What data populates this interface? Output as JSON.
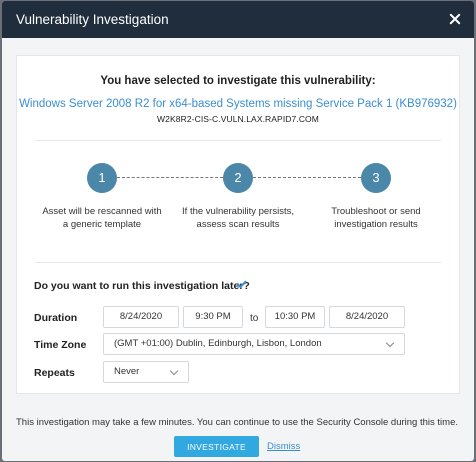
{
  "dialog": {
    "title": "Vulnerability Investigation"
  },
  "summary": {
    "heading": "You have selected to investigate this vulnerability:",
    "vulnerability": "Windows Server 2008 R2 for x64-based Systems missing Service Pack 1 (KB976932)",
    "host": "W2K8R2-CIS-C.VULN.LAX.RAPID7.COM"
  },
  "steps": [
    {
      "number": "1",
      "text": "Asset will be rescanned with a generic template"
    },
    {
      "number": "2",
      "text": "If the vulnerability persists, assess scan results"
    },
    {
      "number": "3",
      "text": "Troubleshoot or send investigation results"
    }
  ],
  "schedule": {
    "question": "Do you want to run this investigation later?",
    "checked": true,
    "duration_label": "Duration",
    "start_date": "8/24/2020",
    "start_time": "9:30 PM",
    "to_label": "to",
    "end_time": "10:30 PM",
    "end_date": "8/24/2020",
    "timezone_label": "Time Zone",
    "timezone_value": "(GMT +01:00) Dublin, Edinburgh, Lisbon, London",
    "repeats_label": "Repeats",
    "repeats_value": "Never"
  },
  "footer": {
    "note": "This investigation may take a few minutes. You can continue to use the Security Console during this time.",
    "investigate_label": "INVESTIGATE",
    "dismiss_label": "Dismiss"
  },
  "colors": {
    "titlebar": "#1f2d3d",
    "accent": "#3a8ed0",
    "step_circle": "#4b87a8",
    "primary_button": "#31a8e0"
  }
}
